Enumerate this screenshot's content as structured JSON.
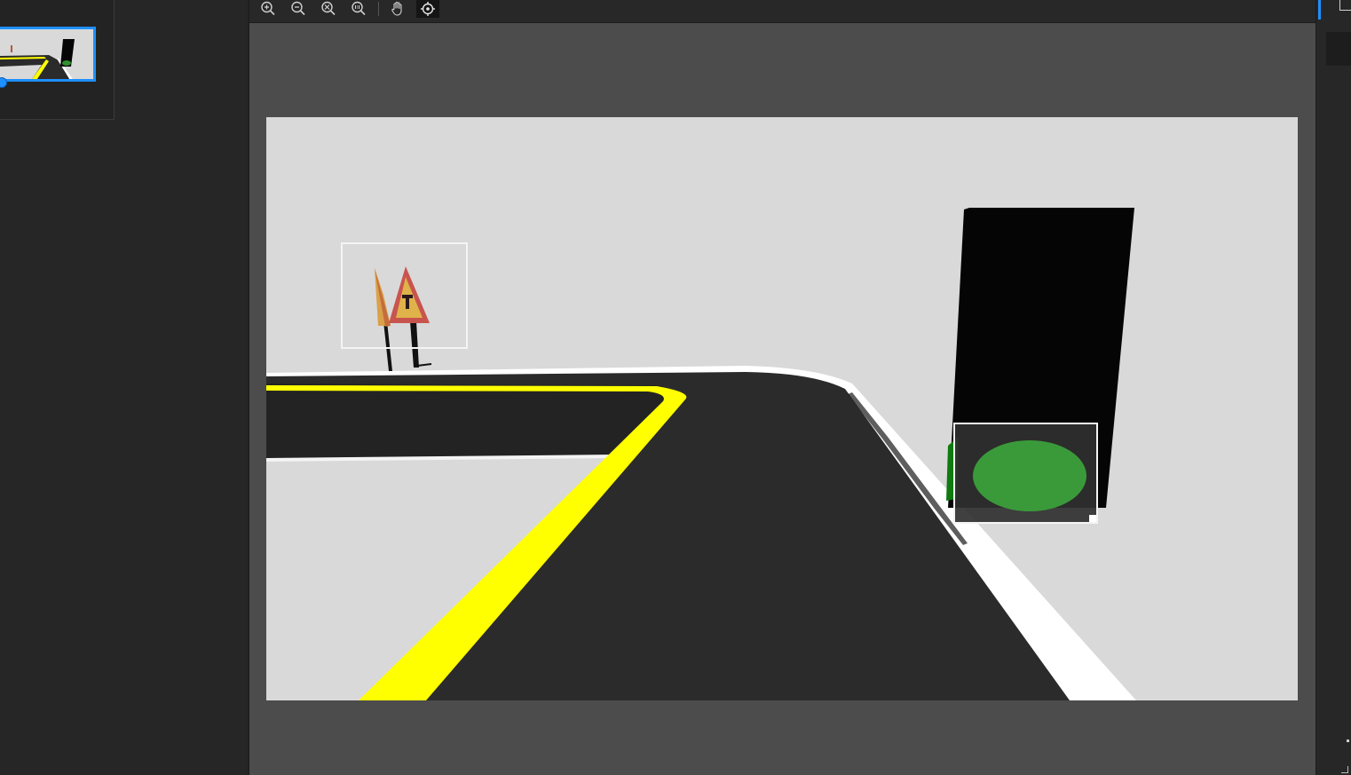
{
  "toolbar": {
    "tools": [
      {
        "name": "zoom-in-icon"
      },
      {
        "name": "zoom-out-icon"
      },
      {
        "name": "zoom-fit-icon"
      },
      {
        "name": "zoom-actual-size-icon"
      },
      {
        "name": "pan-hand-icon"
      },
      {
        "name": "target-select-icon",
        "active": true
      }
    ]
  },
  "canvas": {
    "annotations": [
      {
        "name": "bbox-warning-sign"
      },
      {
        "name": "bbox-traffic-light",
        "selected": true
      }
    ]
  },
  "colors": {
    "accent": "#1e90ff",
    "road": "#2b2b2b",
    "lane_yellow": "#ffff00",
    "lane_white": "#ffffff",
    "ground": "#d9d9d9",
    "light_green": "#3a9a3a",
    "housing": "#050505"
  }
}
